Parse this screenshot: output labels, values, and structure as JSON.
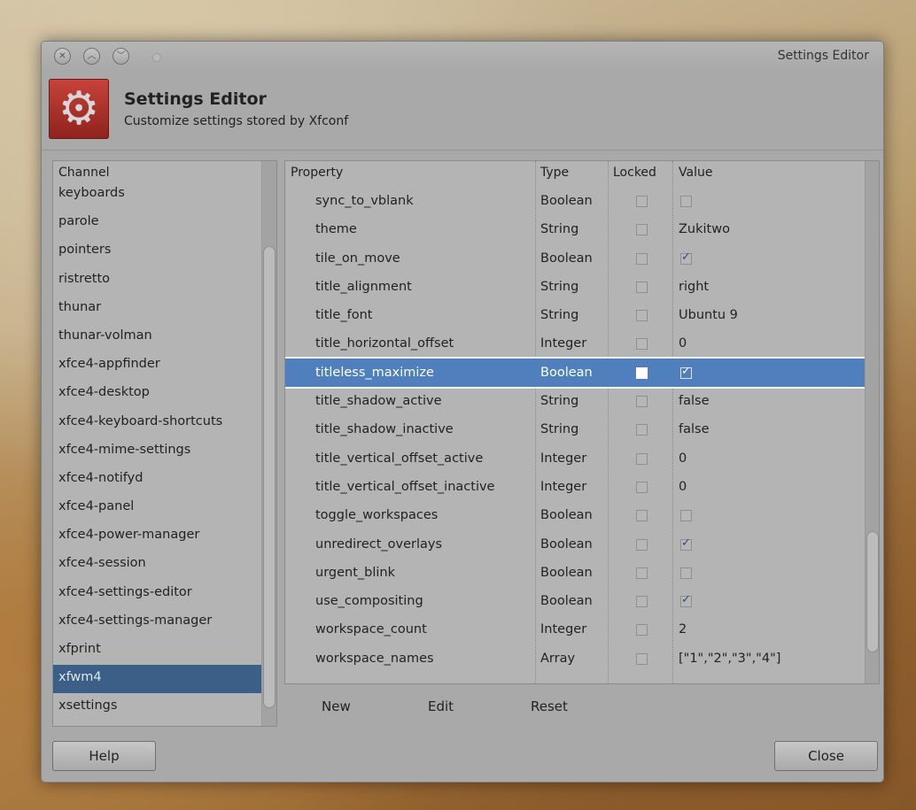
{
  "window": {
    "title": "Settings Editor"
  },
  "header": {
    "title": "Settings Editor",
    "subtitle": "Customize settings stored by Xfconf",
    "icon": "gear-icon"
  },
  "channels": {
    "header": "Channel",
    "items": [
      "keyboards",
      "parole",
      "pointers",
      "ristretto",
      "thunar",
      "thunar-volman",
      "xfce4-appfinder",
      "xfce4-desktop",
      "xfce4-keyboard-shortcuts",
      "xfce4-mime-settings",
      "xfce4-notifyd",
      "xfce4-panel",
      "xfce4-power-manager",
      "xfce4-session",
      "xfce4-settings-editor",
      "xfce4-settings-manager",
      "xfprint",
      "xfwm4",
      "xsettings"
    ],
    "selected": "xfwm4"
  },
  "properties": {
    "headers": {
      "property": "Property",
      "type": "Type",
      "locked": "Locked",
      "value": "Value"
    },
    "rows": [
      {
        "name": "sync_to_vblank",
        "type": "Boolean",
        "locked": false,
        "value": "",
        "checkbox": true,
        "checked": false
      },
      {
        "name": "theme",
        "type": "String",
        "locked": false,
        "value": "Zukitwo",
        "checkbox": false
      },
      {
        "name": "tile_on_move",
        "type": "Boolean",
        "locked": false,
        "value": "",
        "checkbox": true,
        "checked": true
      },
      {
        "name": "title_alignment",
        "type": "String",
        "locked": false,
        "value": "right",
        "checkbox": false
      },
      {
        "name": "title_font",
        "type": "String",
        "locked": false,
        "value": "Ubuntu 9",
        "checkbox": false
      },
      {
        "name": "title_horizontal_offset",
        "type": "Integer",
        "locked": false,
        "value": "0",
        "checkbox": false
      },
      {
        "name": "titleless_maximize",
        "type": "Boolean",
        "locked": false,
        "value": "",
        "checkbox": true,
        "checked": true,
        "selected": true
      },
      {
        "name": "title_shadow_active",
        "type": "String",
        "locked": false,
        "value": "false",
        "checkbox": false
      },
      {
        "name": "title_shadow_inactive",
        "type": "String",
        "locked": false,
        "value": "false",
        "checkbox": false
      },
      {
        "name": "title_vertical_offset_active",
        "type": "Integer",
        "locked": false,
        "value": "0",
        "checkbox": false
      },
      {
        "name": "title_vertical_offset_inactive",
        "type": "Integer",
        "locked": false,
        "value": "0",
        "checkbox": false
      },
      {
        "name": "toggle_workspaces",
        "type": "Boolean",
        "locked": false,
        "value": "",
        "checkbox": true,
        "checked": false
      },
      {
        "name": "unredirect_overlays",
        "type": "Boolean",
        "locked": false,
        "value": "",
        "checkbox": true,
        "checked": true
      },
      {
        "name": "urgent_blink",
        "type": "Boolean",
        "locked": false,
        "value": "",
        "checkbox": true,
        "checked": false
      },
      {
        "name": "use_compositing",
        "type": "Boolean",
        "locked": false,
        "value": "",
        "checkbox": true,
        "checked": true
      },
      {
        "name": "workspace_count",
        "type": "Integer",
        "locked": false,
        "value": "2",
        "checkbox": false
      },
      {
        "name": "workspace_names",
        "type": "Array",
        "locked": false,
        "value": "[\"1\",\"2\",\"3\",\"4\"]",
        "checkbox": false
      }
    ]
  },
  "actions": {
    "new": "New",
    "edit": "Edit",
    "reset": "Reset"
  },
  "buttons": {
    "help": "Help",
    "close": "Close"
  }
}
